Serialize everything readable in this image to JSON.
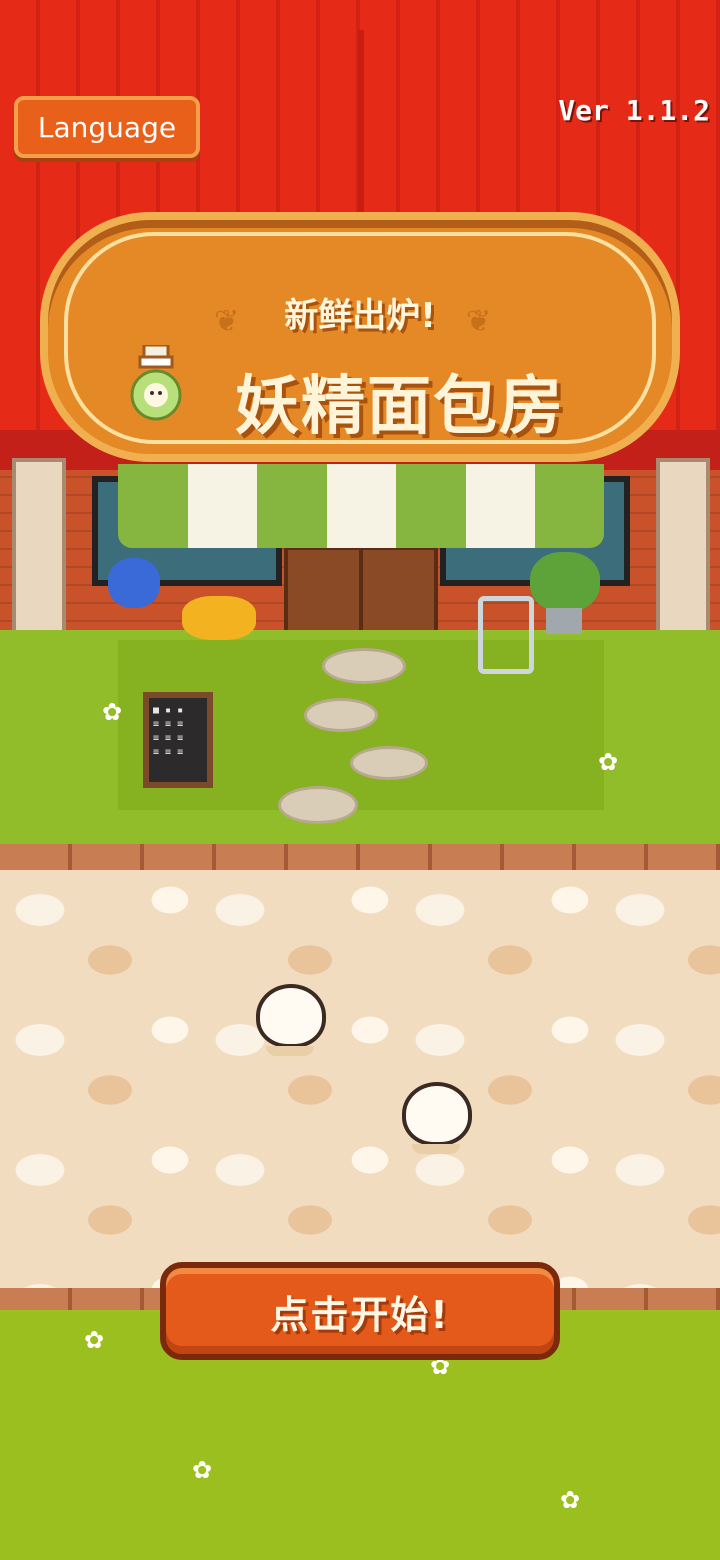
{
  "header": {
    "language_label": "Language",
    "version_label": "Ver 1.1.2"
  },
  "sign": {
    "subtitle": "新鲜出炉!",
    "title": "妖精面包房"
  },
  "menu_board": {
    "text": "■ ▪ ▪\n≡ ≡ ≡\n≡ ≡ ≡\n≡ ≡ ≡"
  },
  "start": {
    "label": "点击开始!"
  },
  "colors": {
    "roof": "#e52a18",
    "button_orange": "#e45a1a",
    "grass": "#9bbf1e",
    "awning_green": "#86b540"
  }
}
